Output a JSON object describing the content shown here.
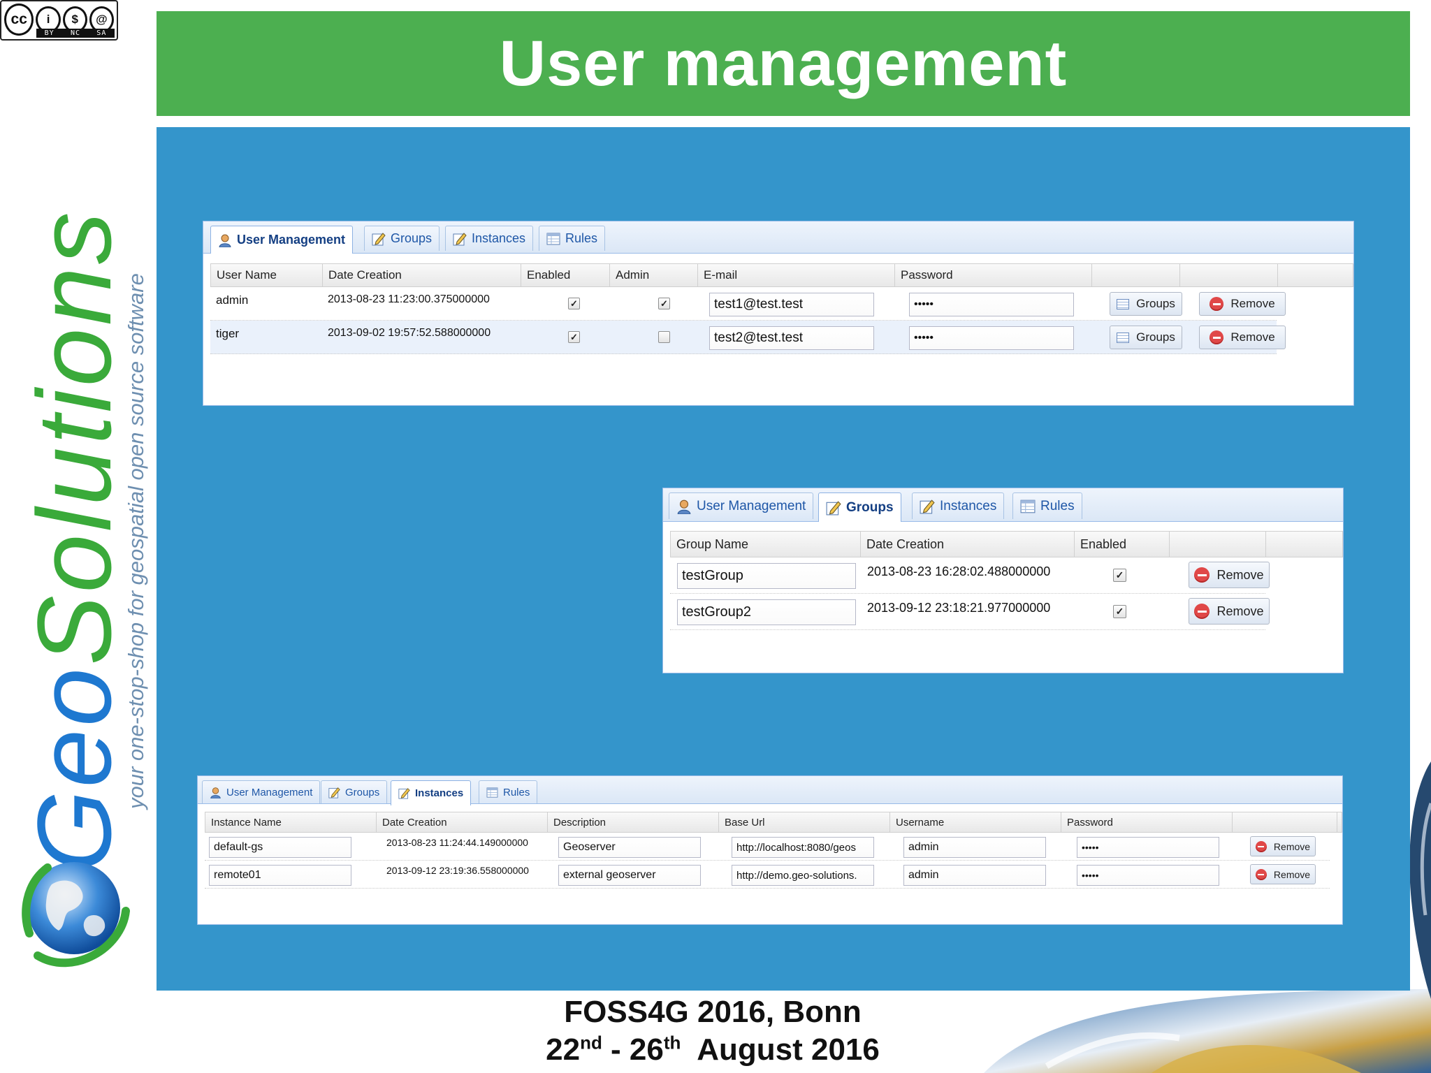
{
  "slide": {
    "title": "User management",
    "license_badge": {
      "symbols": [
        "cc",
        "i",
        "$",
        "@"
      ],
      "labels": [
        "BY",
        "NC",
        "SA"
      ]
    },
    "brand": {
      "wordmark_geo": "Geo",
      "wordmark_solutions": "Solutions",
      "tagline": "your one-stop-shop for geospatial open source software"
    },
    "footer": {
      "line1": "FOSS4G 2016, Bonn",
      "line2_start": "22",
      "line2_start_sup": "nd",
      "line2_sep": " - 26",
      "line2_end_sup": "th",
      "line2_end": "  August 2016"
    },
    "colors": {
      "title_bar": "#4caf50",
      "content_panel": "#3495cb",
      "tab_active_text": "#143f83",
      "tab_text": "#1f57a7"
    }
  },
  "tabs": {
    "user_management": "User Management",
    "groups": "Groups",
    "instances": "Instances",
    "rules": "Rules"
  },
  "users_panel": {
    "active_tab": "user_management",
    "headers": [
      "User Name",
      "Date Creation",
      "Enabled",
      "Admin",
      "E-mail",
      "Password"
    ],
    "rows": [
      {
        "name": "admin",
        "date": "2013-08-23 11:23:00.375000000",
        "enabled": true,
        "admin": true,
        "email": "test1@test.test",
        "password": "•••••",
        "groups_label": "Groups",
        "remove_label": "Remove"
      },
      {
        "name": "tiger",
        "date": "2013-09-02 19:57:52.588000000",
        "enabled": true,
        "admin": false,
        "email": "test2@test.test",
        "password": "•••••",
        "groups_label": "Groups",
        "remove_label": "Remove"
      }
    ]
  },
  "groups_panel": {
    "active_tab": "groups",
    "headers": [
      "Group Name",
      "Date Creation",
      "Enabled"
    ],
    "rows": [
      {
        "name": "testGroup",
        "date": "2013-08-23 16:28:02.488000000",
        "enabled": true,
        "remove_label": "Remove"
      },
      {
        "name": "testGroup2",
        "date": "2013-09-12 23:18:21.977000000",
        "enabled": true,
        "remove_label": "Remove"
      }
    ]
  },
  "instances_panel": {
    "active_tab": "instances",
    "headers": [
      "Instance Name",
      "Date Creation",
      "Description",
      "Base Url",
      "Username",
      "Password"
    ],
    "rows": [
      {
        "name": "default-gs",
        "date": "2013-08-23 11:24:44.149000000",
        "description": "Geoserver",
        "base_url": "http://localhost:8080/geos",
        "username": "admin",
        "password": "•••••",
        "remove_label": "Remove"
      },
      {
        "name": "remote01",
        "date": "2013-09-12 23:19:36.558000000",
        "description": "external geoserver",
        "base_url": "http://demo.geo-solutions.",
        "username": "admin",
        "password": "•••••",
        "remove_label": "Remove"
      }
    ]
  },
  "icons": {
    "user_management": "user-icon",
    "groups": "edit-icon",
    "instances": "edit-icon",
    "rules": "table-icon",
    "remove": "remove-icon",
    "groups_button": "groups-list-icon"
  }
}
